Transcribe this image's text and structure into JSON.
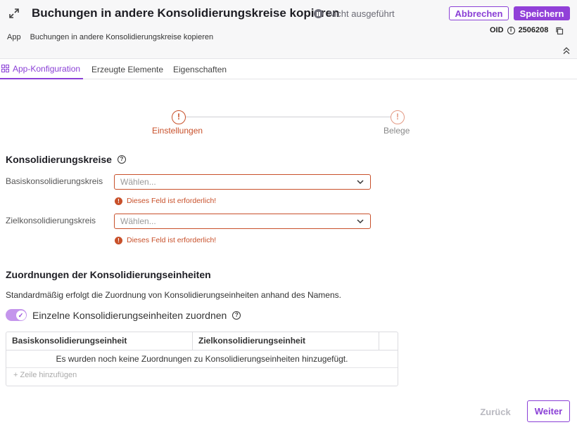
{
  "header": {
    "title": "Buchungen in andere Konsolidierungskreise kopieren",
    "status": "Nicht ausgeführt",
    "cancel_label": "Abbrechen",
    "save_label": "Speichern",
    "oid_label": "OID",
    "oid_value": "2506208",
    "breadcrumb": [
      "App",
      "Buchungen in andere Konsolidierungskreise kopieren"
    ]
  },
  "tabs": [
    {
      "label": "App-Konfiguration",
      "active": true
    },
    {
      "label": "Erzeugte Elemente",
      "active": false
    },
    {
      "label": "Eigenschaften",
      "active": false
    }
  ],
  "stepper": {
    "steps": [
      {
        "label": "Einstellungen",
        "icon": "!"
      },
      {
        "label": "Belege",
        "icon": "!"
      }
    ]
  },
  "section1": {
    "title": "Konsolidierungskreise",
    "fields": [
      {
        "label": "Basiskonsolidierungskreis",
        "placeholder": "Wählen...",
        "error": "Dieses Feld ist erforderlich!"
      },
      {
        "label": "Zielkonsolidierungskreis",
        "placeholder": "Wählen...",
        "error": "Dieses Feld ist erforderlich!"
      }
    ]
  },
  "section2": {
    "title": "Zuordnungen der Konsolidierungseinheiten",
    "description": "Standardmäßig erfolgt die Zuordnung von Konsolidierungseinheiten anhand des Namens.",
    "toggle_label": "Einzelne Konsolidierungseinheiten zuordnen",
    "toggle_on": true,
    "table": {
      "columns": [
        "Basiskonsolidierungseinheit",
        "Zielkonsolidierungseinheit"
      ],
      "empty_text": "Es wurden noch keine Zuordnungen zu Konsolidierungseinheiten hinzugefügt.",
      "add_row_label": "+ Zeile hinzufügen"
    }
  },
  "footer": {
    "back_label": "Zurück",
    "next_label": "Weiter"
  },
  "colors": {
    "accent": "#8a3fd6",
    "error": "#c8502a"
  }
}
